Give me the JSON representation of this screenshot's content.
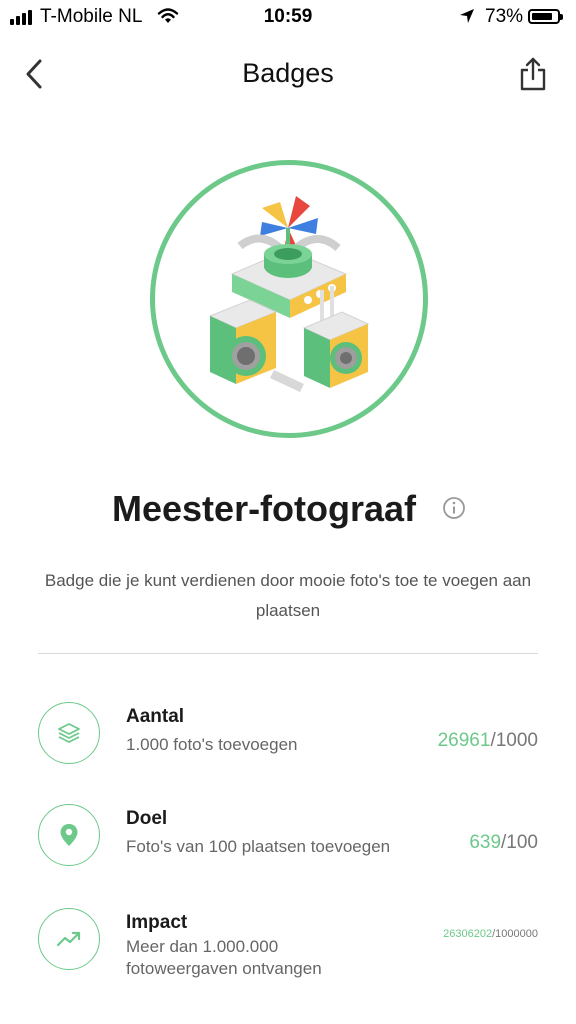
{
  "status_bar": {
    "carrier": "T-Mobile NL",
    "time": "10:59",
    "battery": "73%"
  },
  "nav": {
    "title": "Badges",
    "back_icon": "chevron-left-icon",
    "share_icon": "share-icon"
  },
  "badge": {
    "name": "Meester-fotograaf",
    "description": "Badge die je kunt verdienen door mooie foto's toe te voegen aan plaatsen",
    "accent": "#6cc98a"
  },
  "requirements": [
    {
      "icon": "layers-icon",
      "title": "Aantal",
      "subtitle": "1.000 foto's toevoegen",
      "current": "26961",
      "target": "/1000"
    },
    {
      "icon": "location-pin-icon",
      "title": "Doel",
      "subtitle": "Foto's van 100 plaatsen toevoegen",
      "current": "639",
      "target": "/100"
    },
    {
      "icon": "trending-up-icon",
      "title": "Impact",
      "subtitle": "Meer dan 1.000.000 fotoweergaven ontvangen",
      "current": "26306202",
      "target": "/1000000"
    }
  ]
}
